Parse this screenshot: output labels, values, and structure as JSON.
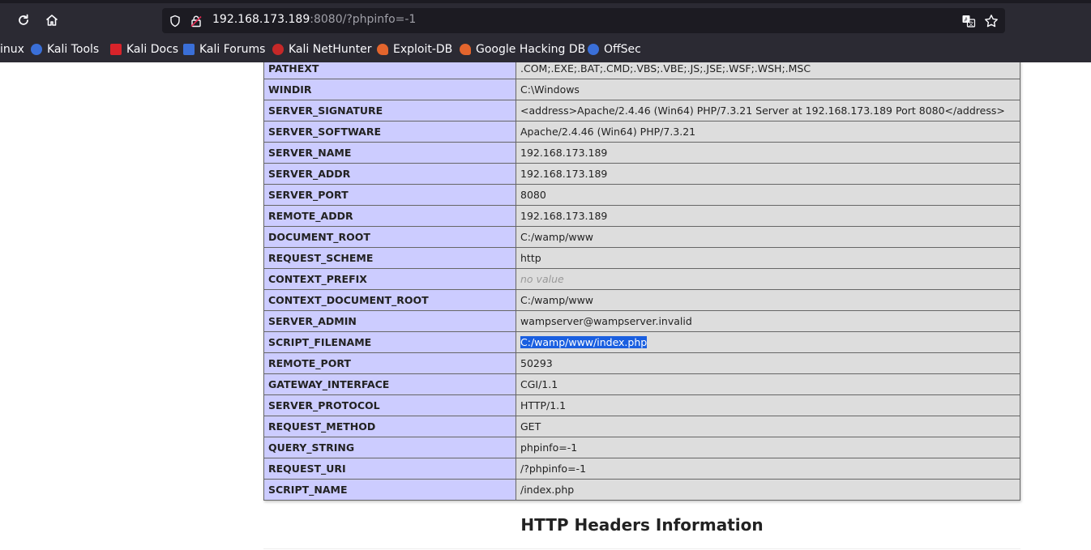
{
  "browser": {
    "url_host": "192.168.173.189",
    "url_rest": ":8080/?phpinfo=-1",
    "icons": {
      "reload": "reload-icon",
      "home": "home-icon",
      "shield": "shield-icon",
      "lock": "lock-icon",
      "translate": "translate-icon",
      "bookmark_star": "star-icon"
    },
    "bookmarks": [
      {
        "label": "inux"
      },
      {
        "label": "Kali Tools"
      },
      {
        "label": "Kali Docs"
      },
      {
        "label": "Kali Forums"
      },
      {
        "label": "Kali NetHunter"
      },
      {
        "label": "Exploit-DB"
      },
      {
        "label": "Google Hacking DB"
      },
      {
        "label": "OffSec"
      }
    ]
  },
  "env_table": {
    "rows": [
      {
        "name": "PATHEXT",
        "value": ".COM;.EXE;.BAT;.CMD;.VBS;.VBE;.JS;.JSE;.WSF;.WSH;.MSC"
      },
      {
        "name": "WINDIR",
        "value": "C:\\Windows"
      },
      {
        "name": "SERVER_SIGNATURE",
        "value": "<address>Apache/2.4.46 (Win64) PHP/7.3.21 Server at 192.168.173.189 Port 8080</address>"
      },
      {
        "name": "SERVER_SOFTWARE",
        "value": "Apache/2.4.46 (Win64) PHP/7.3.21"
      },
      {
        "name": "SERVER_NAME",
        "value": "192.168.173.189"
      },
      {
        "name": "SERVER_ADDR",
        "value": "192.168.173.189"
      },
      {
        "name": "SERVER_PORT",
        "value": "8080"
      },
      {
        "name": "REMOTE_ADDR",
        "value": "192.168.173.189"
      },
      {
        "name": "DOCUMENT_ROOT",
        "value": "C:/wamp/www"
      },
      {
        "name": "REQUEST_SCHEME",
        "value": "http"
      },
      {
        "name": "CONTEXT_PREFIX",
        "value": "no value"
      },
      {
        "name": "CONTEXT_DOCUMENT_ROOT",
        "value": "C:/wamp/www"
      },
      {
        "name": "SERVER_ADMIN",
        "value": "wampserver@wampserver.invalid"
      },
      {
        "name": "SCRIPT_FILENAME",
        "value": "C:/wamp/www/index.php"
      },
      {
        "name": "REMOTE_PORT",
        "value": "50293"
      },
      {
        "name": "GATEWAY_INTERFACE",
        "value": "CGI/1.1"
      },
      {
        "name": "SERVER_PROTOCOL",
        "value": "HTTP/1.1"
      },
      {
        "name": "REQUEST_METHOD",
        "value": "GET"
      },
      {
        "name": "QUERY_STRING",
        "value": "phpinfo=-1"
      },
      {
        "name": "REQUEST_URI",
        "value": "/?phpinfo=-1"
      },
      {
        "name": "SCRIPT_NAME",
        "value": "/index.php"
      }
    ]
  },
  "section_heading": "HTTP Headers Information",
  "colors": {
    "chrome_bg": "#2b2a33",
    "urlbar_bg": "#1c1b22",
    "key_cell": "#ccccff",
    "value_cell": "#dddddd",
    "selection": "#1a5fe0"
  }
}
